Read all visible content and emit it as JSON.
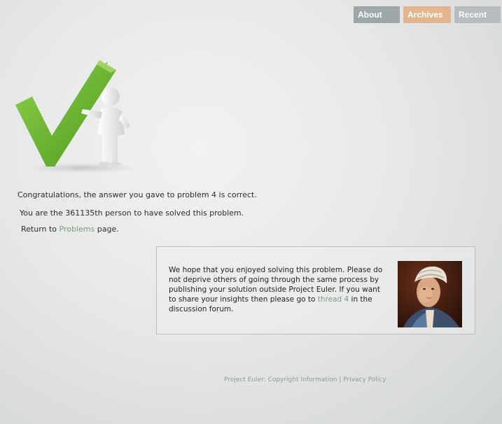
{
  "nav": {
    "items": [
      {
        "label": "About",
        "color": "#9fa6a8"
      },
      {
        "label": "Archives",
        "color": "#e3b58d"
      },
      {
        "label": "Recent",
        "color": "#b7bdbe"
      }
    ]
  },
  "hero": {
    "icon": "checkmark-with-figure-illustration"
  },
  "messages": {
    "congrats": "Congratulations, the answer you gave to problem 4 is correct.",
    "solved_count": "You are the 361135th person to have solved this problem.",
    "return_prefix": "Return to ",
    "return_link": "Problems",
    "return_suffix": " page."
  },
  "info_box": {
    "text_before": "We hope that you enjoyed solving this problem. Please do not deprive others of going through the same process by publishing your solution outside Project Euler. If you want to share your insights then please go to ",
    "thread_link": "thread 4",
    "text_after": " in the discussion forum.",
    "portrait": "euler-portrait"
  },
  "footer": {
    "project_euler": "Project Euler",
    "separator_colon": ": ",
    "copyright": "Copyright Information",
    "separator_pipe": " | ",
    "privacy": "Privacy Policy"
  }
}
